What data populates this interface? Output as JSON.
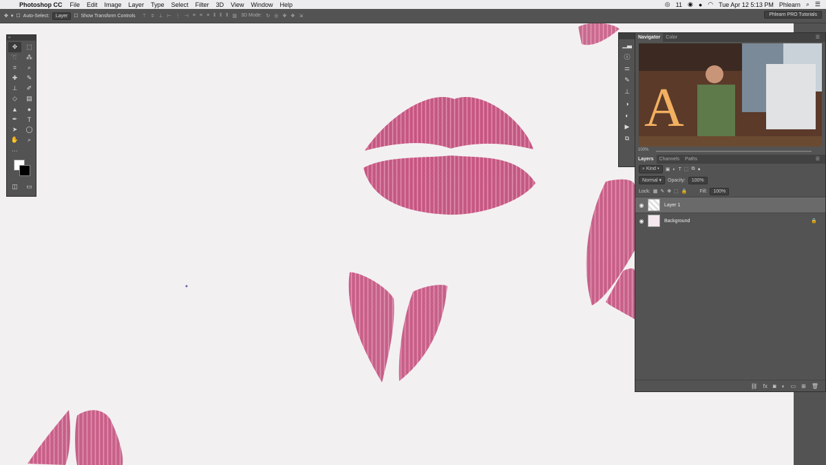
{
  "menubar": {
    "app_name": "Photoshop CC",
    "items": [
      "File",
      "Edit",
      "Image",
      "Layer",
      "Type",
      "Select",
      "Filter",
      "3D",
      "View",
      "Window",
      "Help"
    ],
    "notification_count": "11",
    "datetime": "Tue Apr 12  5:13 PM",
    "user": "Phlearn"
  },
  "options_bar": {
    "auto_select_label": "Auto-Select:",
    "auto_select_value": "Layer",
    "transform_label": "Show Transform Controls",
    "mode_3d_label": "3D Mode:",
    "workspace": "Phlearn PRO Tutorials"
  },
  "navigator": {
    "tabs": [
      "Navigator",
      "Color"
    ],
    "zoom": "100%"
  },
  "layers_panel": {
    "tabs": [
      "Layers",
      "Channels",
      "Paths"
    ],
    "kind_label": "Kind",
    "blend_mode": "Normal",
    "opacity_label": "Opacity:",
    "opacity_value": "100%",
    "lock_label": "Lock:",
    "fill_label": "Fill:",
    "fill_value": "100%",
    "layers": [
      {
        "name": "Layer 1",
        "selected": true
      },
      {
        "name": "Background",
        "locked": true
      }
    ]
  },
  "colors": {
    "lipstick": "#c8507e",
    "canvas": "#f3f0f1",
    "panel": "#535353"
  }
}
